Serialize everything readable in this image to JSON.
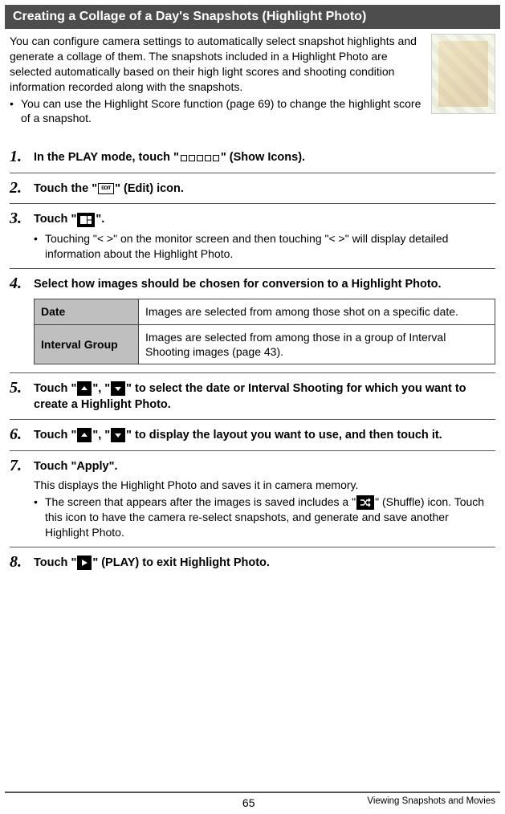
{
  "header": {
    "title": "Creating a Collage of a Day's Snapshots (Highlight Photo)"
  },
  "intro": {
    "paragraph": "You can configure camera settings to automatically select snapshot highlights and generate a collage of them. The snapshots included in a Highlight Photo are selected automatically based on their high light scores and shooting condition information recorded along with the snapshots.",
    "bullet": "You can use the Highlight Score function (page 69) to change the highlight score of a snapshot."
  },
  "steps": {
    "s1": {
      "num": "1.",
      "title_a": "In the PLAY mode, touch \"",
      "title_b": "\" (Show Icons)."
    },
    "s2": {
      "num": "2.",
      "title_a": "Touch the \"",
      "title_b": "\" (Edit) icon.",
      "edit_label": "EDIT"
    },
    "s3": {
      "num": "3.",
      "title_a": "Touch \"",
      "title_b": "\".",
      "bullet": "Touching \"< >\" on the monitor screen and then touching \"< >\" will display detailed information about the Highlight Photo."
    },
    "s4": {
      "num": "4.",
      "title": "Select how images should be chosen for conversion to a Highlight Photo.",
      "table": {
        "r1h": "Date",
        "r1d": "Images are selected from among those shot on a specific date.",
        "r2h": "Interval Group",
        "r2d": "Images are selected from among those in a group of Interval Shooting images (page 43)."
      }
    },
    "s5": {
      "num": "5.",
      "title_a": "Touch \"",
      "title_b": "\", \"",
      "title_c": "\" to select the date or Interval Shooting for which you want to create a Highlight Photo."
    },
    "s6": {
      "num": "6.",
      "title_a": "Touch \"",
      "title_b": "\", \"",
      "title_c": "\" to display the layout you want to use, and then touch it."
    },
    "s7": {
      "num": "7.",
      "title": "Touch \"Apply\".",
      "body": "This displays the Highlight Photo and saves it in camera memory.",
      "bullet_a": "The screen that appears after the images is saved includes a \"",
      "bullet_b": "\" (Shuffle) icon. Touch this icon to have the camera re-select snapshots, and generate and save another Highlight Photo."
    },
    "s8": {
      "num": "8.",
      "title_a": "Touch \"",
      "title_b": "\" (PLAY) to exit Highlight Photo."
    }
  },
  "footer": {
    "page": "65",
    "section": "Viewing Snapshots and Movies"
  }
}
